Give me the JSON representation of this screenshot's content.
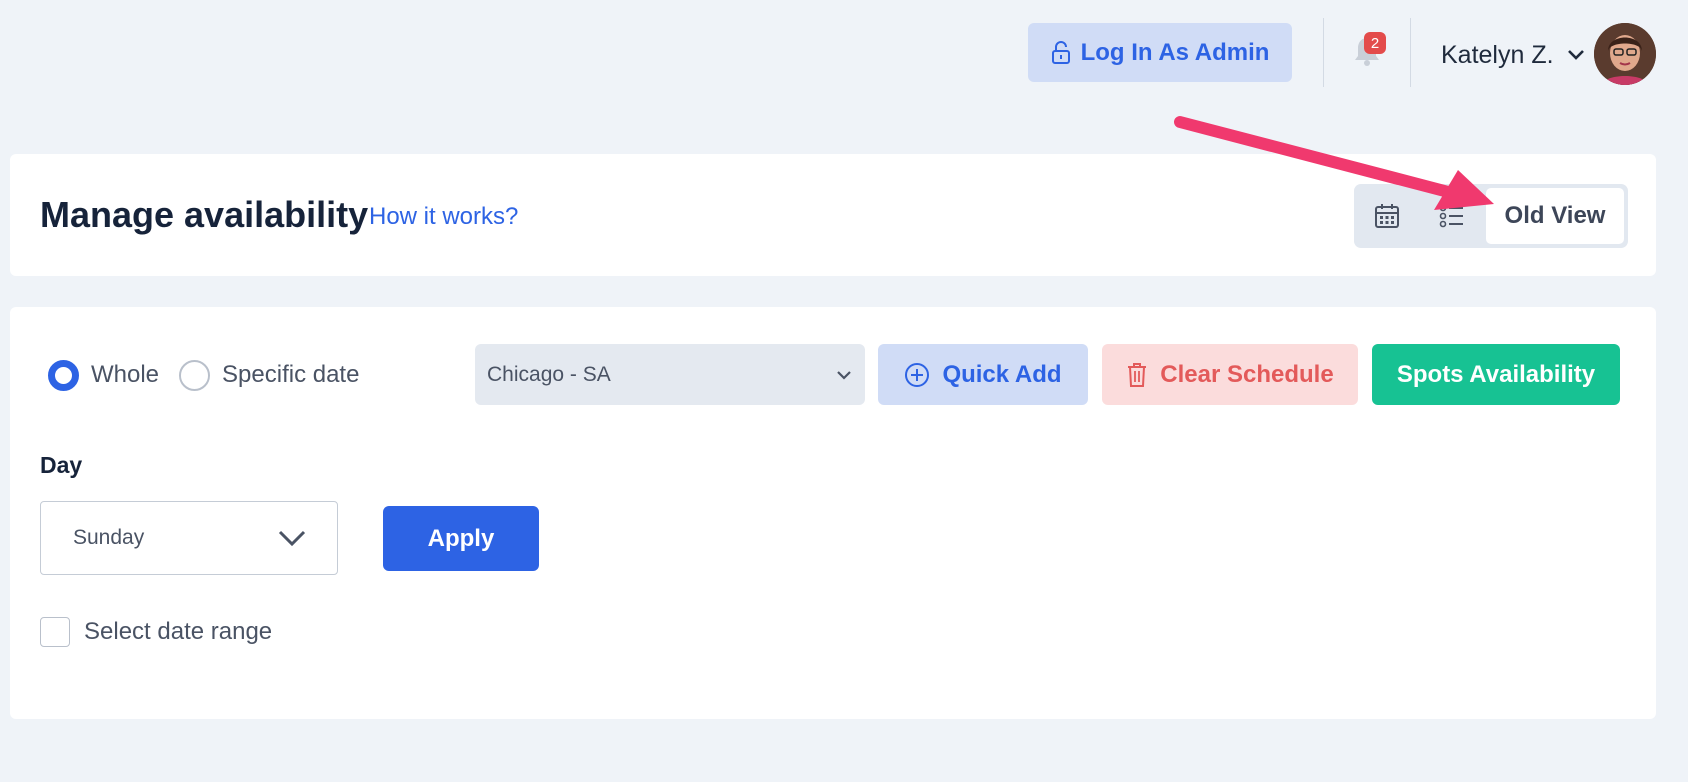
{
  "topbar": {
    "admin_button_label": "Log In As Admin",
    "notification_count": "2",
    "user_name": "Katelyn Z."
  },
  "header": {
    "title": "Manage availability",
    "help_link": "How it works?",
    "view_toggle": {
      "calendar_icon": "calendar-icon",
      "list_icon": "list-icon",
      "old_view_label": "Old View"
    }
  },
  "filters": {
    "radio_options": [
      {
        "label": "Whole",
        "selected": true
      },
      {
        "label": "Specific date",
        "selected": false
      }
    ],
    "location_value": "Chicago - SA",
    "quick_add_label": "Quick Add",
    "clear_schedule_label": "Clear Schedule",
    "spots_availability_label": "Spots Availability",
    "day_label": "Day",
    "day_value": "Sunday",
    "apply_label": "Apply",
    "date_range_label": "Select date range"
  },
  "colors": {
    "primary": "#2d63e4",
    "primary_soft": "#d0dcf6",
    "danger": "#e35a5a",
    "danger_soft": "#fbdcdc",
    "success": "#17c293",
    "annotation": "#f0396e",
    "background": "#eff3f8"
  }
}
